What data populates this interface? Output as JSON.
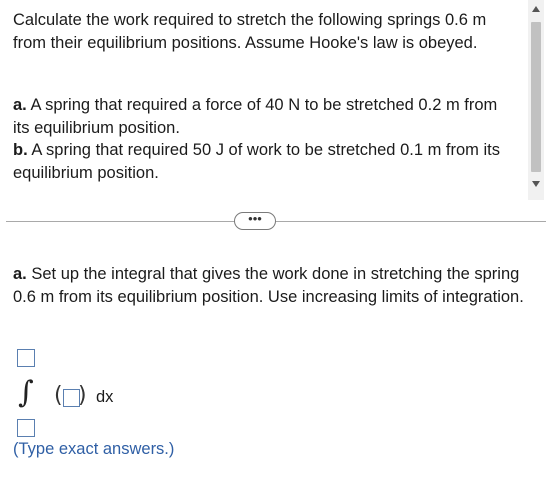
{
  "question": {
    "intro": "Calculate the work required to stretch the following springs 0.6 m from their equilibrium positions. Assume Hooke's law is obeyed.",
    "part_a_label": "a.",
    "part_a_text": "A spring that required a force of 40 N to be stretched 0.2 m from its equilibrium position.",
    "part_b_label": "b.",
    "part_b_text": "A spring that required 50 J of work to be stretched 0.1 m from its equilibrium position."
  },
  "more_button_label": "•••",
  "task": {
    "label": "a.",
    "text": "Set up the integral that gives the work done in stretching the spring 0.6 m from its equilibrium position. Use increasing limits of integration."
  },
  "integral": {
    "sign": "∫",
    "upper_limit_value": "",
    "lower_limit_value": "",
    "integrand_value": "",
    "open_paren": "(",
    "close_paren": ")",
    "differential": "dx"
  },
  "hint": "(Type exact answers.)",
  "icons": {
    "scroll_up": "triangle-up-icon",
    "scroll_down": "triangle-down-icon"
  },
  "colors": {
    "hint_blue": "#2f5fa5",
    "input_border": "#5a7fb0"
  }
}
